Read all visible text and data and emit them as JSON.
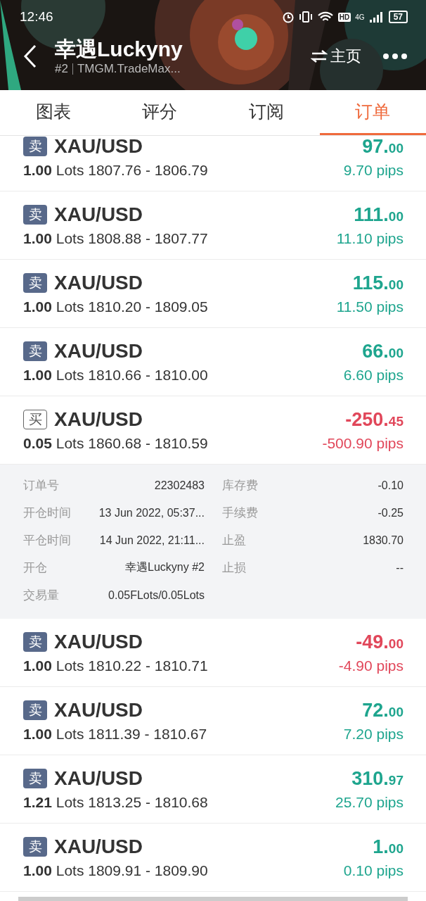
{
  "status_bar": {
    "time": "12:46",
    "hd": "HD",
    "network": "4G",
    "battery": "57"
  },
  "header": {
    "title": "幸遇Luckyny",
    "rank": "#2",
    "server": "TMGM.TradeMax...",
    "home_button": "主页"
  },
  "tabs": [
    {
      "label": "图表",
      "selected": false
    },
    {
      "label": "评分",
      "selected": false
    },
    {
      "label": "订阅",
      "selected": false
    },
    {
      "label": "订单",
      "selected": true
    }
  ],
  "orders": [
    {
      "kind": "sell",
      "side": "卖",
      "symbol": "XAU/USD",
      "lots": "**1.00** Lots 1807.76 - 1806.79",
      "profit_int": "97.",
      "profit_dec": "00",
      "pips": "9.70 pips",
      "loss": false,
      "expanded": false
    },
    {
      "kind": "sell",
      "side": "卖",
      "symbol": "XAU/USD",
      "lots": "**1.00** Lots 1808.88 - 1807.77",
      "profit_int": "111.",
      "profit_dec": "00",
      "pips": "11.10 pips",
      "loss": false,
      "expanded": false
    },
    {
      "kind": "sell",
      "side": "卖",
      "symbol": "XAU/USD",
      "lots": "**1.00** Lots 1810.20 - 1809.05",
      "profit_int": "115.",
      "profit_dec": "00",
      "pips": "11.50 pips",
      "loss": false,
      "expanded": false
    },
    {
      "kind": "sell",
      "side": "卖",
      "symbol": "XAU/USD",
      "lots": "**1.00** Lots 1810.66 - 1810.00",
      "profit_int": "66.",
      "profit_dec": "00",
      "pips": "6.60 pips",
      "loss": false,
      "expanded": false
    },
    {
      "kind": "buy",
      "side": "买",
      "symbol": "XAU/USD",
      "lots": "**0.05** Lots 1860.68 - 1810.59",
      "profit_int": "-250.",
      "profit_dec": "45",
      "pips": "-500.90 pips",
      "loss": true,
      "expanded": true,
      "details": [
        {
          "label": "订单号",
          "value": "22302483"
        },
        {
          "label": "库存费",
          "value": "-0.10"
        },
        {
          "label": "开仓时间",
          "value": "13 Jun 2022, 05:37..."
        },
        {
          "label": "手续费",
          "value": "-0.25"
        },
        {
          "label": "平仓时间",
          "value": "14 Jun 2022, 21:11..."
        },
        {
          "label": "止盈",
          "value": "1830.70"
        },
        {
          "label": "开仓",
          "value": "幸遇Luckyny  #2"
        },
        {
          "label": "止损",
          "value": "--"
        },
        {
          "label": "交易量",
          "value": "0.05FLots/0.05Lots"
        }
      ]
    },
    {
      "kind": "sell",
      "side": "卖",
      "symbol": "XAU/USD",
      "lots": "**1.00** Lots 1810.22 - 1810.71",
      "profit_int": "-49.",
      "profit_dec": "00",
      "pips": "-4.90 pips",
      "loss": true,
      "expanded": false
    },
    {
      "kind": "sell",
      "side": "卖",
      "symbol": "XAU/USD",
      "lots": "**1.00** Lots 1811.39 - 1810.67",
      "profit_int": "72.",
      "profit_dec": "00",
      "pips": "7.20 pips",
      "loss": false,
      "expanded": false
    },
    {
      "kind": "sell",
      "side": "卖",
      "symbol": "XAU/USD",
      "lots": "**1.21** Lots 1813.25 - 1810.68",
      "profit_int": "310.",
      "profit_dec": "97",
      "pips": "25.70 pips",
      "loss": false,
      "expanded": false
    },
    {
      "kind": "sell",
      "side": "卖",
      "symbol": "XAU/USD",
      "lots": "**1.00** Lots 1809.91 - 1809.90",
      "profit_int": "1.",
      "profit_dec": "00",
      "pips": "0.10 pips",
      "loss": false,
      "expanded": false
    }
  ]
}
